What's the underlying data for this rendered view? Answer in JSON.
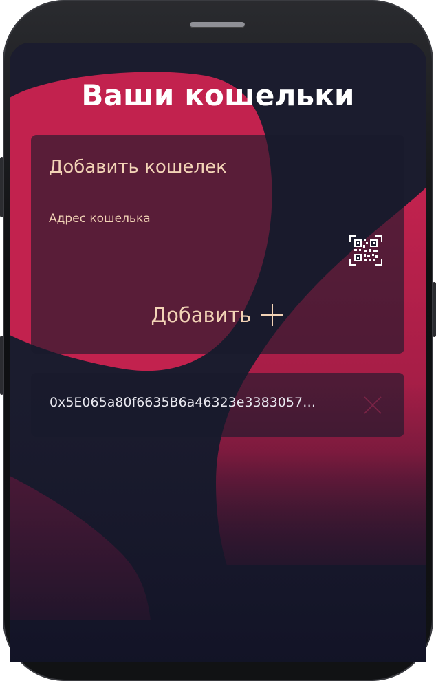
{
  "screen": {
    "title": "Ваши кошельки"
  },
  "add_wallet": {
    "title": "Добавить кошелек",
    "address_label": "Адрес кошелька",
    "address_value": "",
    "qr_icon": "qr-code-icon",
    "add_button_label": "Добавить",
    "add_icon": "plus-icon"
  },
  "wallets": [
    {
      "address": "0x5E065a80f6635B6a46323e3383057…",
      "remove_icon": "close-icon"
    }
  ],
  "colors": {
    "accent": "#c2224e",
    "text_peach": "#f2d3b6",
    "background": "#1b1c2e"
  }
}
